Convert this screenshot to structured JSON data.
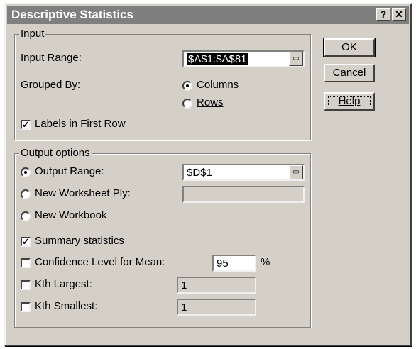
{
  "dialog": {
    "title": "Descriptive Statistics",
    "help_glyph": "?",
    "close_glyph": "✕"
  },
  "input_group": {
    "legend": "Input",
    "input_range_label": "Input Range:",
    "input_range_value": "$A$1:$A$81",
    "grouped_by_label": "Grouped By:",
    "columns_label": "Columns",
    "columns_selected": true,
    "rows_label": "Rows",
    "rows_selected": false,
    "labels_first_row_label": "Labels in First Row",
    "labels_first_row_checked": true
  },
  "output_group": {
    "legend": "Output options",
    "output_range_label": "Output Range:",
    "output_range_value": "$D$1",
    "output_range_selected": true,
    "new_worksheet_label": "New Worksheet Ply:",
    "new_worksheet_value": "",
    "new_workbook_label": "New Workbook",
    "summary_stats_label": "Summary statistics",
    "summary_stats_checked": true,
    "confidence_label": "Confidence Level for Mean:",
    "confidence_value": "95",
    "confidence_unit": "%",
    "kth_largest_label": "Kth Largest:",
    "kth_largest_value": "1",
    "kth_smallest_label": "Kth Smallest:",
    "kth_smallest_value": "1"
  },
  "buttons": {
    "ok": "OK",
    "cancel": "Cancel",
    "help": "Help"
  },
  "icons": {
    "collapse": "collapse-dialog-icon",
    "check": "✓"
  }
}
